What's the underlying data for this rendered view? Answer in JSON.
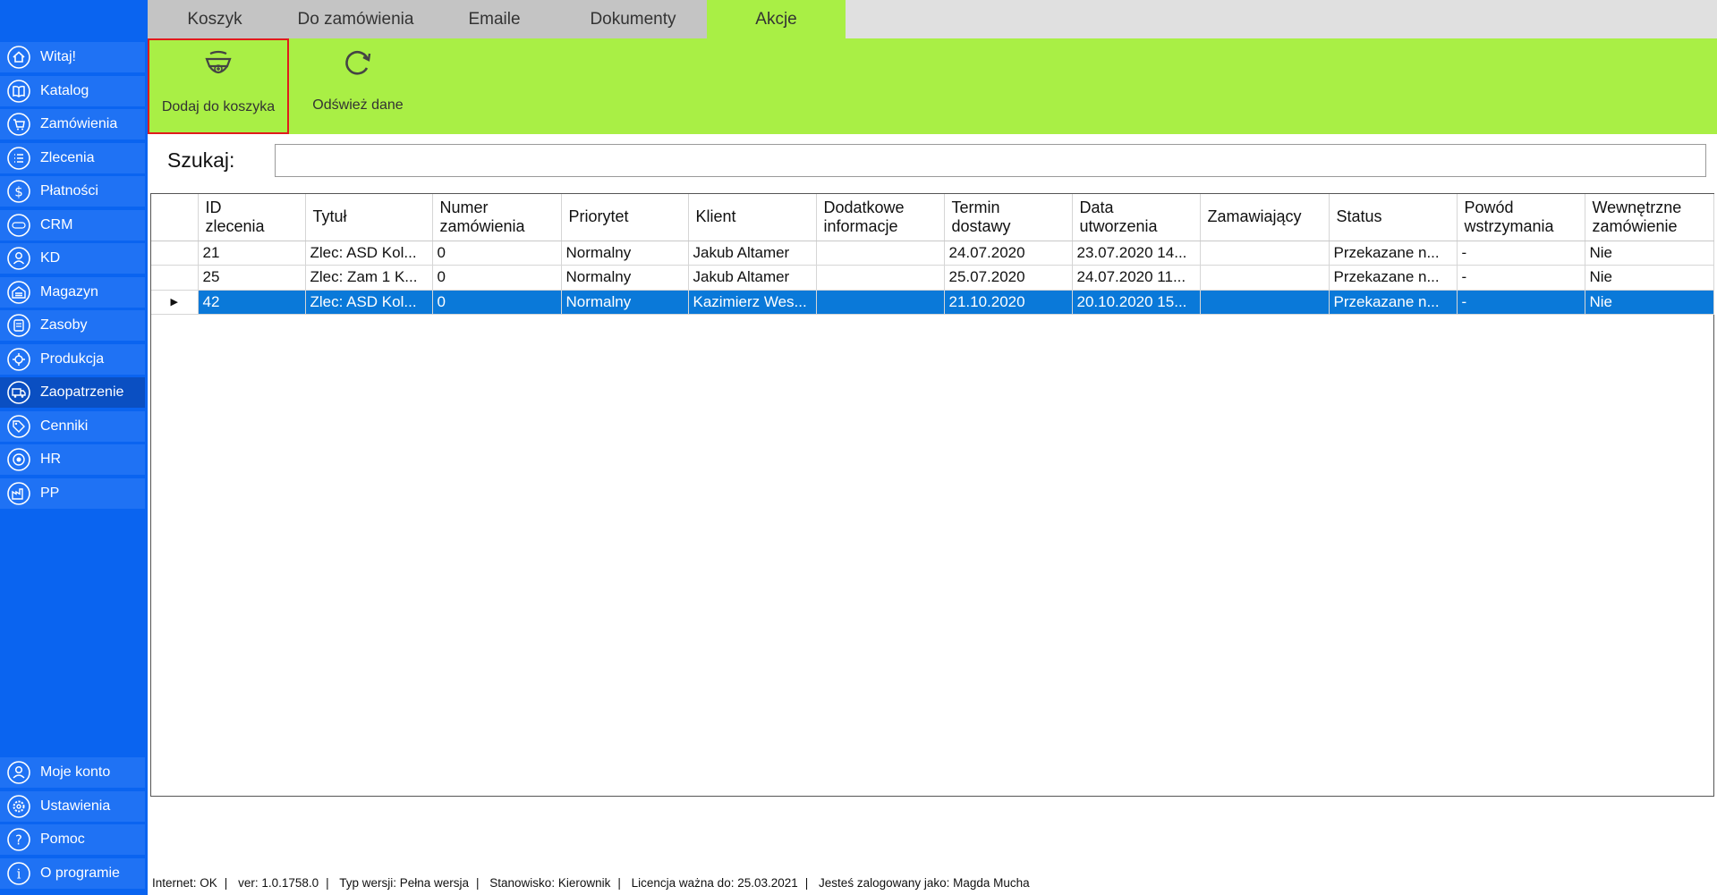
{
  "sidebar": {
    "items": [
      {
        "label": "Witaj!",
        "icon": "home-icon"
      },
      {
        "label": "Katalog",
        "icon": "book-icon"
      },
      {
        "label": "Zamówienia",
        "icon": "cart-icon"
      },
      {
        "label": "Zlecenia",
        "icon": "list-icon"
      },
      {
        "label": "Płatności",
        "icon": "dollar-icon"
      },
      {
        "label": "CRM",
        "icon": "crm-icon"
      },
      {
        "label": "KD",
        "icon": "person-icon"
      },
      {
        "label": "Magazyn",
        "icon": "warehouse-icon"
      },
      {
        "label": "Zasoby",
        "icon": "resources-icon"
      },
      {
        "label": "Produkcja",
        "icon": "production-icon"
      },
      {
        "label": "Zaopatrzenie",
        "icon": "truck-icon"
      },
      {
        "label": "Cenniki",
        "icon": "tag-icon"
      },
      {
        "label": "HR",
        "icon": "hr-icon"
      },
      {
        "label": "PP",
        "icon": "factory-icon"
      }
    ],
    "bottom_items": [
      {
        "label": "Moje konto",
        "icon": "account-icon"
      },
      {
        "label": "Ustawienia",
        "icon": "gear-icon"
      },
      {
        "label": "Pomoc",
        "icon": "help-icon"
      },
      {
        "label": "O programie",
        "icon": "info-icon"
      }
    ],
    "active": "Zaopatrzenie"
  },
  "tabs": [
    {
      "label": "Koszyk"
    },
    {
      "label": "Do zamówienia"
    },
    {
      "label": "Emaile"
    },
    {
      "label": "Dokumenty"
    },
    {
      "label": "Akcje"
    }
  ],
  "ribbon": {
    "add_to_cart": "Dodaj do koszyka",
    "refresh": "Odśwież dane"
  },
  "search": {
    "label": "Szukaj:",
    "value": ""
  },
  "table": {
    "columns": [
      "ID\nzlecenia",
      "Tytuł",
      "Numer\nzamówienia",
      "Priorytet",
      "Klient",
      "Dodatkowe\ninformacje",
      "Termin\ndostawy",
      "Data\nutworzenia",
      "Zamawiający",
      "Status",
      "Powód\nwstrzymania",
      "Wewnętrzne\nzamówienie"
    ],
    "rows": [
      [
        "21",
        "Zlec: ASD Kol...",
        "0",
        "Normalny",
        "Jakub  Altamer",
        "",
        "24.07.2020",
        "23.07.2020 14...",
        "",
        "Przekazane n...",
        "-",
        "Nie"
      ],
      [
        "25",
        "Zlec: Zam 1 K...",
        "0",
        "Normalny",
        "Jakub  Altamer",
        "",
        "25.07.2020",
        "24.07.2020 11...",
        "",
        "Przekazane n...",
        "-",
        "Nie"
      ],
      [
        "42",
        "Zlec: ASD Kol...",
        "0",
        "Normalny",
        "Kazimierz Wes...",
        "",
        "21.10.2020",
        "20.10.2020 15...",
        "",
        "Przekazane n...",
        "-",
        "Nie"
      ]
    ],
    "selected_row": 2
  },
  "status": {
    "internet": "Internet: OK",
    "version": "ver: 1.0.1758.0",
    "type": "Typ wersji: Pełna wersja",
    "position": "Stanowisko: Kierownik",
    "license": "Licencja ważna do: 25.03.2021",
    "user": "Jesteś zalogowany jako: Magda Mucha"
  },
  "colors": {
    "sidebar": "#0a64f0",
    "accent": "#a9ef45",
    "selection": "#0a79d9"
  }
}
